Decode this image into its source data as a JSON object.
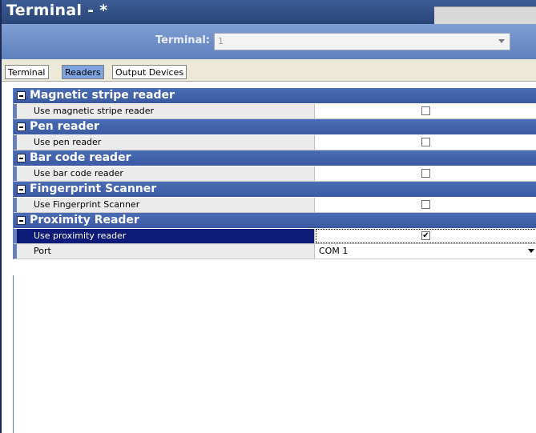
{
  "window": {
    "title": "Terminal - *"
  },
  "selector": {
    "label": "Terminal:",
    "value": "1"
  },
  "tabs": [
    {
      "label": "Terminal"
    },
    {
      "label": "Readers"
    },
    {
      "label": "Output Devices"
    }
  ],
  "groups": [
    {
      "title": "Magnetic stripe reader",
      "rows": [
        {
          "label": "Use magnetic stripe reader",
          "checked": ""
        }
      ]
    },
    {
      "title": "Pen reader",
      "rows": [
        {
          "label": "Use pen reader",
          "checked": ""
        }
      ]
    },
    {
      "title": "Bar code reader",
      "rows": [
        {
          "label": "Use bar code reader",
          "checked": ""
        }
      ]
    },
    {
      "title": "Fingerprint Scanner",
      "rows": [
        {
          "label": "Use Fingerprint Scanner",
          "checked": ""
        }
      ]
    },
    {
      "title": "Proximity Reader",
      "rows": [
        {
          "label": "Use proximity reader",
          "checked": "✔"
        },
        {
          "label": "Port",
          "value": "COM 1"
        }
      ]
    }
  ],
  "colors": {
    "title_bar": "#2a4578",
    "group_header": "#3b5aa3",
    "selected_row": "#0c1a78",
    "active_tab": "#7ea4e0"
  }
}
